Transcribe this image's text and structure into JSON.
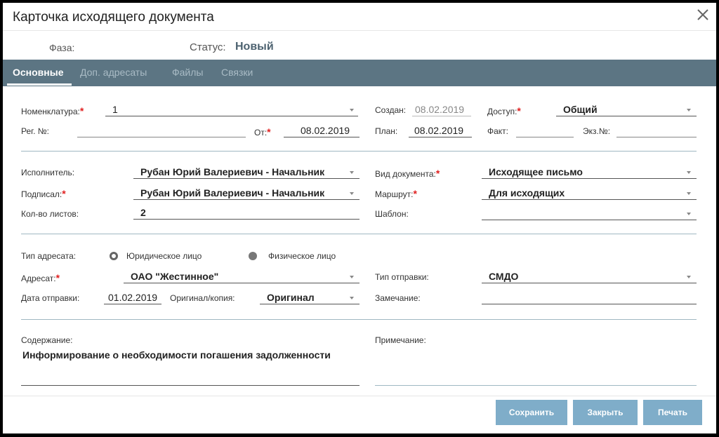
{
  "dialog": {
    "title": "Карточка исходящего документа",
    "close_icon": "close-icon"
  },
  "header": {
    "phase_label": "Фаза:",
    "status_label": "Статус:",
    "status_value": "Новый"
  },
  "tabs": [
    {
      "label": "Основные",
      "active": true
    },
    {
      "label": "Доп. адресаты",
      "active": false
    },
    {
      "label": "Файлы",
      "active": false
    },
    {
      "label": "Связки",
      "active": false
    }
  ],
  "form": {
    "nomenclature": {
      "label": "Номенклатура:",
      "value": "1"
    },
    "created": {
      "label": "Создан:",
      "value": "08.02.2019"
    },
    "access": {
      "label": "Доступ:",
      "value": "Общий"
    },
    "reg_no": {
      "label": "Рег. №:",
      "value": ""
    },
    "from": {
      "label": "От:",
      "value": "08.02.2019"
    },
    "plan": {
      "label": "План:",
      "value": "08.02.2019"
    },
    "fact": {
      "label": "Факт:",
      "value": ""
    },
    "copies": {
      "label": "Экз.№:",
      "value": ""
    },
    "executor": {
      "label": "Исполнитель:",
      "value": "Рубан Юрий Валериевич - Начальник"
    },
    "doc_type": {
      "label": "Вид документа:",
      "value": "Исходящее письмо"
    },
    "signed": {
      "label": "Подписал:",
      "value": "Рубан Юрий Валериевич - Начальник"
    },
    "route": {
      "label": "Маршрут:",
      "value": "Для исходящих"
    },
    "sheets": {
      "label": "Кол-во листов:",
      "value": "2"
    },
    "template": {
      "label": "Шаблон:",
      "value": ""
    },
    "addressee_type": {
      "label": "Тип адресата:",
      "options": [
        "Юридическое лицо",
        "Физическое лицо"
      ],
      "selected": "Юридическое лицо"
    },
    "addressee": {
      "label": "Адресат:",
      "value": "ОАО \"Жестинное\""
    },
    "send_type": {
      "label": "Тип отправки:",
      "value": "СМДО"
    },
    "send_date": {
      "label": "Дата отправки:",
      "value": "01.02.2019"
    },
    "original_copy": {
      "label": "Оригинал/копия:",
      "value": "Оригинал"
    },
    "remark": {
      "label": "Замечание:",
      "value": ""
    },
    "content": {
      "label": "Содержание:",
      "value": "Информирование о необходимости погашения задолженности"
    },
    "note": {
      "label": "Примечание:",
      "value": ""
    }
  },
  "buttons": {
    "save": "Сохранить",
    "close": "Закрыть",
    "print": "Печать"
  },
  "colors": {
    "tabbar": "#5c7583",
    "button": "#7fadc9",
    "required": "#e02020"
  }
}
